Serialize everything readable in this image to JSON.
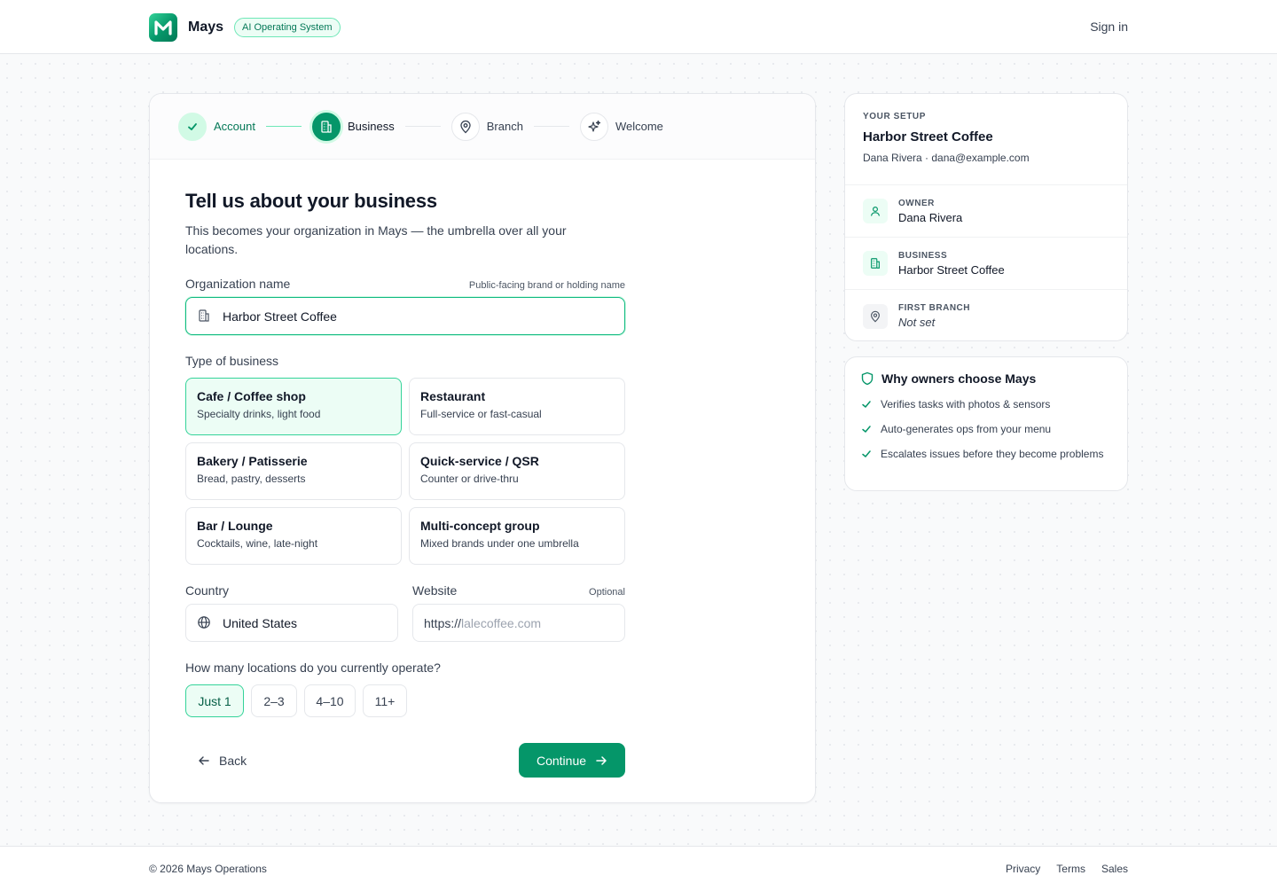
{
  "header": {
    "brand_name": "Mays",
    "badge": "AI Operating System",
    "sign_in": "Sign in"
  },
  "stepper": {
    "steps": [
      {
        "label": "Account",
        "state": "done"
      },
      {
        "label": "Business",
        "state": "active"
      },
      {
        "label": "Branch",
        "state": "upcoming"
      },
      {
        "label": "Welcome",
        "state": "upcoming"
      }
    ]
  },
  "form": {
    "title": "Tell us about your business",
    "subtitle": "This becomes your organization in Mays — the umbrella over all your locations.",
    "org": {
      "label": "Organization name",
      "hint": "Public-facing brand or holding name",
      "value": "Harbor Street Coffee"
    },
    "business_type": {
      "label": "Type of business",
      "options": [
        {
          "title": "Cafe / Coffee shop",
          "sub": "Specialty drinks, light food",
          "selected": true
        },
        {
          "title": "Restaurant",
          "sub": "Full-service or fast-casual",
          "selected": false
        },
        {
          "title": "Bakery / Patisserie",
          "sub": "Bread, pastry, desserts",
          "selected": false
        },
        {
          "title": "Quick-service / QSR",
          "sub": "Counter or drive-thru",
          "selected": false
        },
        {
          "title": "Bar / Lounge",
          "sub": "Cocktails, wine, late-night",
          "selected": false
        },
        {
          "title": "Multi-concept group",
          "sub": "Mixed brands under one umbrella",
          "selected": false
        }
      ]
    },
    "country": {
      "label": "Country",
      "value": "United States"
    },
    "website": {
      "label": "Website",
      "hint": "Optional",
      "prefix": "https://",
      "placeholder": "lalecoffee.com"
    },
    "locations": {
      "label": "How many locations do you currently operate?",
      "options": [
        "Just 1",
        "2–3",
        "4–10",
        "11+"
      ],
      "selected": "Just 1"
    },
    "back": "Back",
    "continue": "Continue"
  },
  "setup": {
    "eyebrow": "YOUR SETUP",
    "name": "Harbor Street Coffee",
    "contact": "Dana Rivera · dana@example.com",
    "rows": [
      {
        "label": "OWNER",
        "value": "Dana Rivera",
        "icon": "user-icon"
      },
      {
        "label": "BUSINESS",
        "value": "Harbor Street Coffee",
        "icon": "building-icon"
      },
      {
        "label": "FIRST BRANCH",
        "value": "Not set",
        "icon": "map-pin-icon"
      }
    ]
  },
  "why": {
    "title": "Why owners choose Mays",
    "items": [
      "Verifies tasks with photos & sensors",
      "Auto-generates ops from your menu",
      "Escalates issues before they become problems"
    ]
  },
  "footer": {
    "copyright": "© 2026 Mays Operations",
    "links": [
      "Privacy",
      "Terms",
      "Sales"
    ]
  },
  "colors": {
    "accent": "#059669",
    "accent_light": "#ecfdf5",
    "accent_border": "#34d399"
  }
}
